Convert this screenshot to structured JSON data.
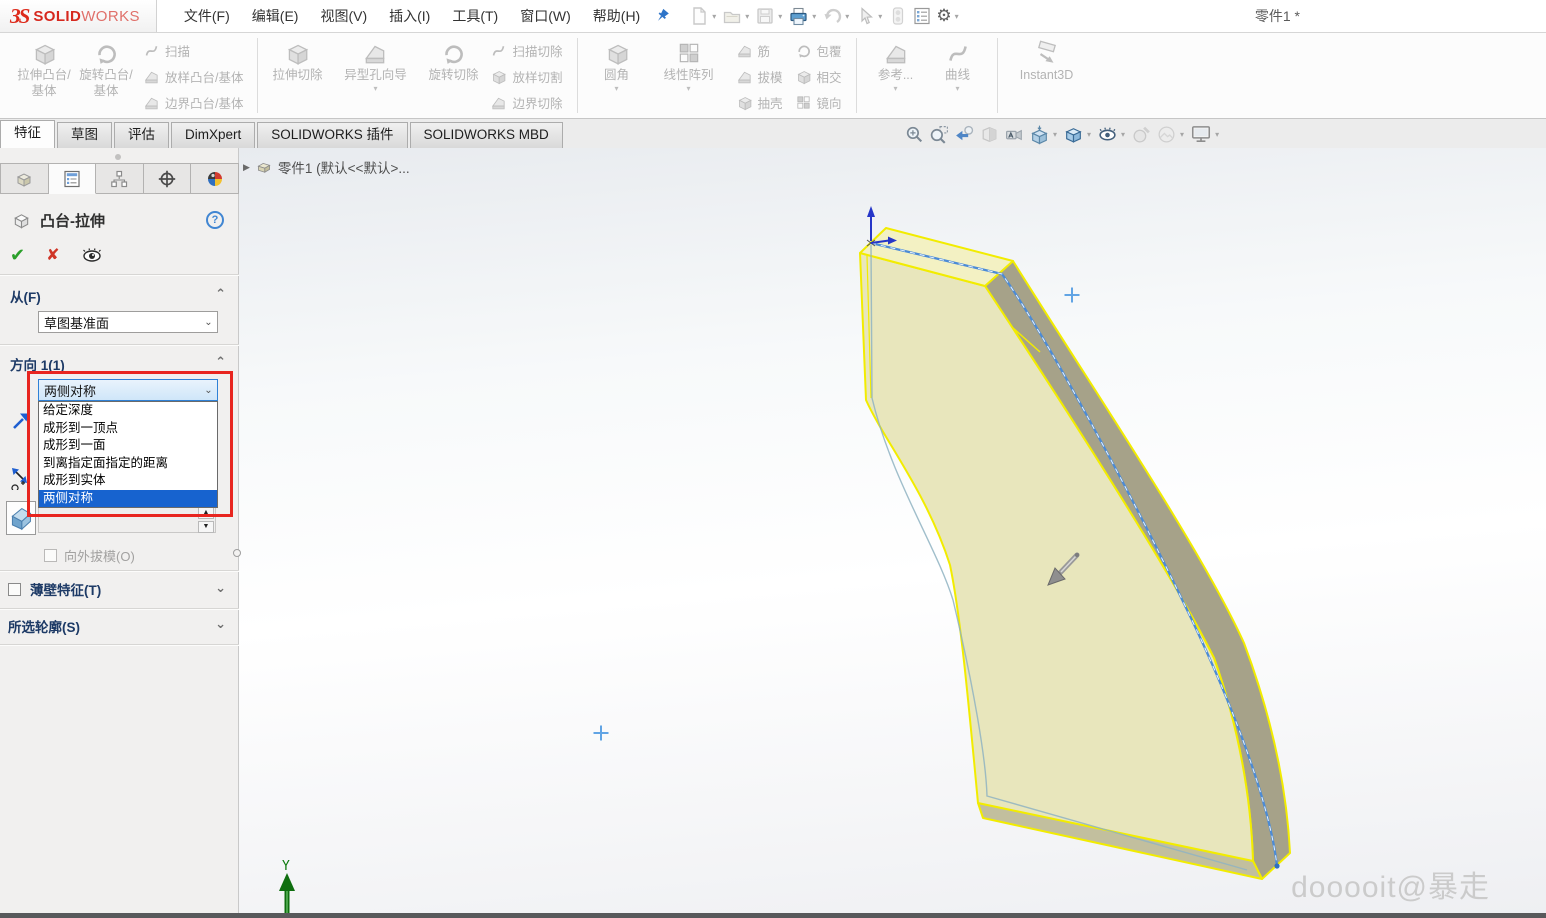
{
  "window": {
    "title": "零件1 *",
    "brand": {
      "mark": "ЗS",
      "solid": "SOLID",
      "works": "WORKS"
    }
  },
  "menubar": {
    "items": [
      "文件(F)",
      "编辑(E)",
      "视图(V)",
      "插入(I)",
      "工具(T)",
      "窗口(W)",
      "帮助(H)"
    ]
  },
  "quickbar": {
    "icons": [
      "new-document",
      "open-document",
      "save",
      "print",
      "undo",
      "select",
      "performance-pipeline",
      "options-list",
      "settings-gear"
    ]
  },
  "ribbon": {
    "groups": [
      {
        "big": [
          {
            "label": "拉伸凸台/基体"
          },
          {
            "label": "旋转凸台/基体"
          }
        ],
        "smalls": [
          [
            "扫描",
            "放样凸台/基体",
            "边界凸台/基体"
          ]
        ]
      },
      {
        "big": [
          {
            "label": "拉伸切除"
          },
          {
            "label": "异型孔向导",
            "caret": "▾"
          },
          {
            "label": "旋转切除"
          }
        ],
        "smalls": [
          [
            "扫描切除",
            "放样切割",
            "边界切除"
          ]
        ]
      },
      {
        "big": [
          {
            "label": "圆角",
            "caret": "▾"
          },
          {
            "label": "线性阵列",
            "caret": "▾"
          }
        ],
        "smalls": [
          [
            "筋",
            "拔模",
            "抽壳"
          ],
          [
            "包覆",
            "相交",
            "镜向"
          ]
        ]
      },
      {
        "big": [
          {
            "label": "参考...",
            "caret": "▾"
          },
          {
            "label": "曲线",
            "caret": "▾"
          }
        ],
        "smalls": []
      },
      {
        "big": [
          {
            "label": "Instant3D"
          }
        ],
        "smalls": []
      }
    ]
  },
  "tabs": {
    "items": [
      {
        "label": "特征",
        "active": true
      },
      {
        "label": "草图"
      },
      {
        "label": "评估"
      },
      {
        "label": "DimXpert"
      },
      {
        "label": "SOLIDWORKS 插件"
      },
      {
        "label": "SOLIDWORKS MBD"
      }
    ]
  },
  "viewbar": {
    "icons": [
      "zoom-fit",
      "zoom-area",
      "previous-view",
      "section-view",
      "annotation-view",
      "view-orientation",
      "display-style",
      "hide-show-items",
      "edit-appearance",
      "apply-scene",
      "view-settings"
    ]
  },
  "panel": {
    "manager_tabs": [
      "feature-manager",
      "property-manager",
      "configuration-manager",
      "dimxpert-manager",
      "display-manager"
    ],
    "header": {
      "title": "凸台-拉伸"
    },
    "from_section": {
      "label": "从(F)",
      "value": "草图基准面"
    },
    "direction1": {
      "label": "方向 1(1)",
      "value": "两侧对称",
      "options": [
        "给定深度",
        "成形到一顶点",
        "成形到一面",
        "到离指定面指定的距离",
        "成形到实体",
        "两侧对称"
      ],
      "selected_option": "两侧对称",
      "draft_outward_label": "向外拔模(O)"
    },
    "thin_feature": {
      "label": "薄壁特征(T)"
    },
    "selected_contours": {
      "label": "所选轮廓(S)"
    }
  },
  "viewport": {
    "tree_item": "零件1 (默认<<默认>...",
    "watermark": "dooooit@暴走",
    "axis_y_label": "Y"
  },
  "colors": {
    "selection_blue": "#1763cf",
    "highlight_red": "#e8251f",
    "preview_edge_yellow": "#f2ec00",
    "preview_face": "#e8e6bc",
    "preview_top_face": "#f3f1c3",
    "preview_side_face": "#a6a289",
    "sketch_blue": "#4c8bd5",
    "brand_red": "#d6281e",
    "axis_green": "#0f6e0f"
  }
}
